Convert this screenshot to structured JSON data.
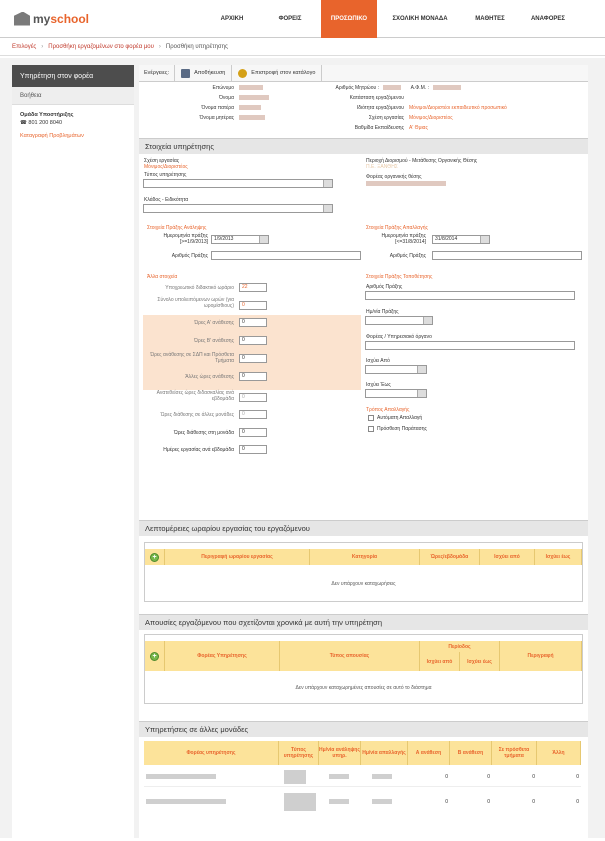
{
  "app": {
    "logo_prefix": "my",
    "logo_suffix": "school"
  },
  "nav": [
    "ΑΡΧΙΚΗ",
    "ΦΟΡΕΙΣ",
    "ΠΡΟΣΩΠΙΚΟ",
    "ΣΧΟΛΙΚΗ ΜΟΝΑΔΑ",
    "ΜΑΘΗΤΕΣ",
    "ΑΝΑΦΟΡΕΣ"
  ],
  "breadcrumb": {
    "items": [
      "Επιλογές",
      "Προσθήκη εργαζομένων στο φορέα μου",
      "Προσθήκη υπηρέτησης"
    ]
  },
  "sidebar": {
    "title": "Υπηρέτηση στον φορέα",
    "help": "Βοήθεια",
    "support_title": "Ομάδα Υποστήριξης",
    "support_phone": "801 200 8040",
    "issues": "Καταγραφή Προβλημάτων"
  },
  "toolbar": {
    "label": "Ενέργειες:",
    "save": "Αποθήκευση",
    "back": "Επιστροφή στον κατάλογο"
  },
  "info": {
    "surname": "Επώνυμο",
    "name": "Όνομα",
    "father": "Όνομα πατέρα",
    "mother": "Όνομα μητέρας",
    "reg_no": "Αριθμός Μητρώου :",
    "afm": "Α.Φ.Μ. :",
    "category_label": "Κατάσταση εργαζόμενου",
    "specialty_label": "Ιδιότητα εργαζόμενου",
    "specialty_value": "Μόνιμοι/Διοριστέοι εκπαιδευτικό προσωπικό",
    "relation_label": "Σχέση εργασίας",
    "relation_value": "Μόνιμος/Διοριστέος",
    "grade_label": "Βαθμίδα Εκπαίδευσης",
    "grade_value": "Α' Θμιας"
  },
  "service": {
    "section": "Στοιχεία υπηρέτησης",
    "relation_label": "Σχέση εργασίας",
    "relation_value": "Μόνιμος/Διοριστέος",
    "type_label": "Τύπος υπηρέτησης",
    "branch_label": "Κλάδος - Ειδικότητα",
    "org_label": "Περιοχή Διορισμού - Μετάθεσης Οργανικής Θέσης",
    "org_value": "Π.Ε. ΞΑΝΘΗΣ",
    "org_unit_label": "Φορέας οργανικής θέσης",
    "assume_title": "Στοιχεία Πράξης Ανάληψης",
    "assume_date_label": "Ημερομηνία πράξης",
    "assume_date_hint": "[>=1/9/2013]",
    "assume_date": "1/9/2013",
    "assume_no_label": "Αριθμός Πράξης",
    "release_title": "Στοιχεία Πράξης Απαλλαγής",
    "release_date_label": "Ημερομηνία πράξης",
    "release_date_hint": "[<=31/8/2014]",
    "release_date": "31/8/2014",
    "release_no_label": "Αριθμός Πράξης",
    "other_title": "Άλλα στοιχεία",
    "hours_label": "Υποχρεωτικό διδακτικό ωράριο",
    "hours_value": "22",
    "remaining_label": "Σύνολο υπολειπόμενων ωρών (για ωρομίσθιους)",
    "remaining_value": "0",
    "a_label": "Ώρες Α' ανάθεσης",
    "b_label": "Ώρες Β' ανάθεσης",
    "zep_label": "Ώρες ανάθεσης σε ΣΔΠ και Πρόσθετα Τμήματα",
    "other_label": "Άλλες ώρες ανάθεσης",
    "other_hours_label": "Ανατεθείσες ώρες διδασκαλίας ανά εβδομάδα",
    "units_label": "Ώρες διάθεσης σε άλλες μονάδες",
    "unit_hours_label": "Ώρες διάθεσης στη μονάδα",
    "days_label": "Ημέρες εργασίας ανά εβδομάδα",
    "zero": "0",
    "placement_title": "Στοιχεία Πράξης Τοποθέτησης",
    "placement_no_label": "Αριθμός Πράξης",
    "placement_date_label": "Ημ/νία Πράξης",
    "placement_org_label": "Φορέας / Υπηρεσιακό όργανο",
    "valid_from_label": "Ισχύει Από",
    "valid_to_label": "Ισχύει Έως",
    "release_reason_title": "Τρόπος Απαλλαγής",
    "auto_release": "Αυτόματη Απαλλαγή",
    "extend": "Πρόσθεση Παράτασης"
  },
  "schedule": {
    "section": "Λεπτομέρειες ωραρίου εργασίας του εργαζόμενου",
    "cols": [
      "Περιγραφή ωραρίου εργασίας",
      "Κατηγορία",
      "Ώρες/εβδομάδα",
      "Ισχύει από",
      "Ισχύει έως"
    ],
    "empty": "Δεν υπάρχουν καταχωρήσεις"
  },
  "absences": {
    "section": "Απουσίες εργαζόμενου που σχετίζονται χρονικά με αυτή την υπηρέτηση",
    "cols": [
      "Φορέας Υπηρέτησης",
      "Τύπος απουσίας",
      "Περίοδος",
      "Ισχύει από",
      "Ισχύει έως",
      "Περιγραφή"
    ],
    "empty": "Δεν υπάρχουν καταχωρημένες απουσίες σε αυτό το διάστημα"
  },
  "other_units": {
    "section": "Υπηρετήσεις σε άλλες μονάδες",
    "cols": [
      "Φορέας υπηρέτησης",
      "Τύπος υπηρέτησης",
      "Ημ/νία ανάληψης υπηρ.",
      "Ημ/νία απαλλαγής",
      "Α ανάθεση",
      "Β ανάθεση",
      "Σε πρόσθετα τμήματα",
      "Άλλη"
    ],
    "rows": [
      [
        "0",
        "0",
        "0",
        "0"
      ],
      [
        "0",
        "0",
        "0",
        "0"
      ]
    ]
  },
  "colors": {
    "accent": "#e8642c",
    "peach": "#fbe3cf",
    "table_head": "#fce39a"
  }
}
